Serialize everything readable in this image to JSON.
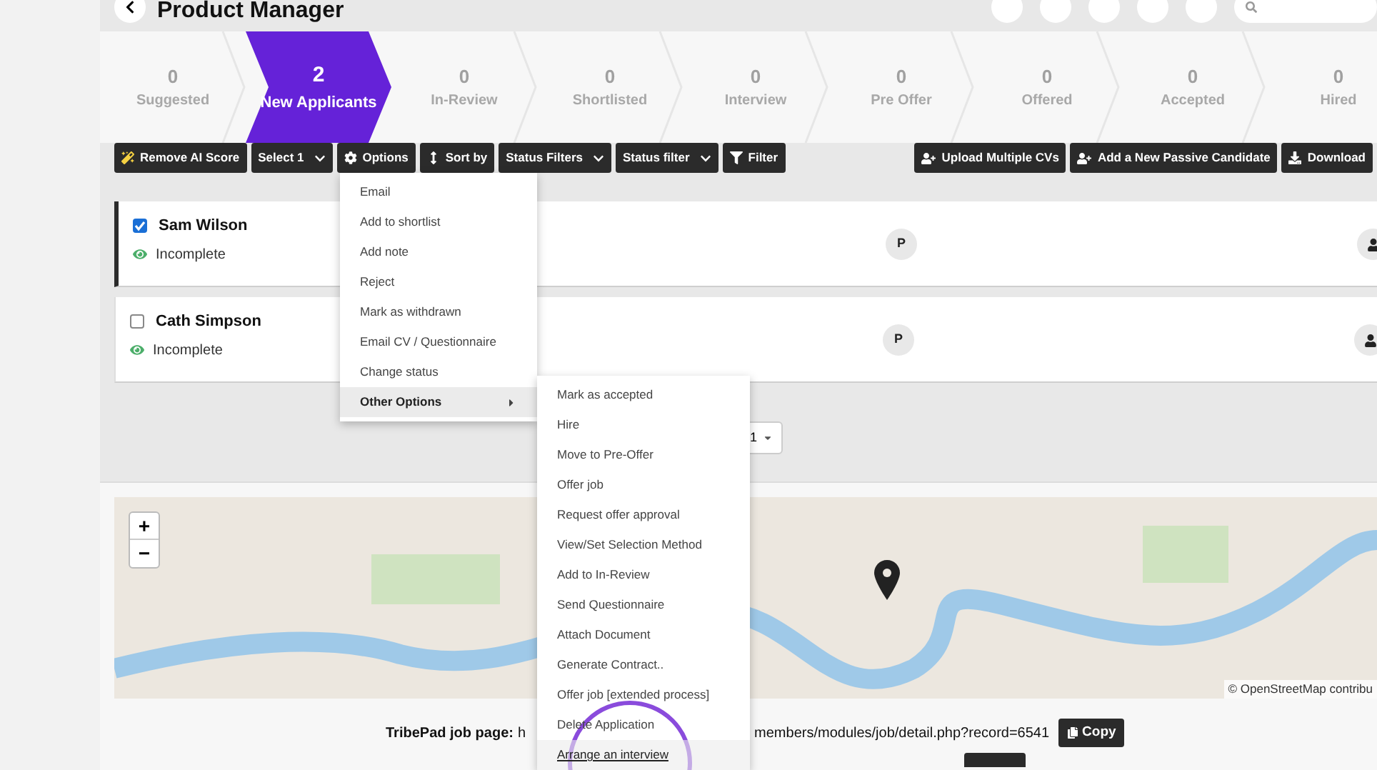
{
  "header": {
    "title": "Product Manager"
  },
  "stages": [
    {
      "count": "0",
      "label": "Suggested",
      "selected": false
    },
    {
      "count": "2",
      "label": "New Applicants",
      "selected": true
    },
    {
      "count": "0",
      "label": "In-Review",
      "selected": false
    },
    {
      "count": "0",
      "label": "Shortlisted",
      "selected": false
    },
    {
      "count": "0",
      "label": "Interview",
      "selected": false
    },
    {
      "count": "0",
      "label": "Pre Offer",
      "selected": false
    },
    {
      "count": "0",
      "label": "Offered",
      "selected": false
    },
    {
      "count": "0",
      "label": "Accepted",
      "selected": false
    },
    {
      "count": "0",
      "label": "Hired",
      "selected": false
    }
  ],
  "toolbar_left": [
    {
      "label": "Remove AI Score",
      "kind": "sparkle"
    },
    {
      "label": "Select 1",
      "kind": "dropdown"
    },
    {
      "label": "Options",
      "kind": "gear"
    },
    {
      "label": "Sort by",
      "kind": "sort"
    },
    {
      "label": "Status Filters",
      "kind": "dropdown"
    },
    {
      "label": "Status filter",
      "kind": "dropdown"
    },
    {
      "label": "Filter",
      "kind": "filter"
    }
  ],
  "toolbar_right": [
    {
      "label": "Upload Multiple CVs",
      "kind": "user-plus"
    },
    {
      "label": "Add a New Passive Candidate",
      "kind": "user-plus"
    },
    {
      "label": "Download",
      "kind": "download"
    }
  ],
  "candidates": [
    {
      "name": "Sam Wilson",
      "checked": true,
      "status": "Incomplete",
      "initial": "P"
    },
    {
      "name": "Cath Simpson",
      "checked": false,
      "status": "Incomplete",
      "initial": "P"
    }
  ],
  "pagination": {
    "page": "1"
  },
  "options_menu": [
    {
      "label": "Email",
      "selected": false,
      "has_submenu": false
    },
    {
      "label": "Add to shortlist",
      "selected": false,
      "has_submenu": false
    },
    {
      "label": "Add note",
      "selected": false,
      "has_submenu": false
    },
    {
      "label": "Reject",
      "selected": false,
      "has_submenu": false
    },
    {
      "label": "Mark as withdrawn",
      "selected": false,
      "has_submenu": false
    },
    {
      "label": "Email CV / Questionnaire",
      "selected": false,
      "has_submenu": false
    },
    {
      "label": "Change status",
      "selected": false,
      "has_submenu": false
    },
    {
      "label": "Other Options",
      "selected": true,
      "has_submenu": true
    }
  ],
  "other_options_menu": [
    {
      "label": "Mark as accepted",
      "selected": false
    },
    {
      "label": "Hire",
      "selected": false
    },
    {
      "label": "Move to Pre-Offer",
      "selected": false
    },
    {
      "label": "Offer job",
      "selected": false
    },
    {
      "label": "Request offer approval",
      "selected": false
    },
    {
      "label": "View/Set Selection Method",
      "selected": false
    },
    {
      "label": "Add to In-Review",
      "selected": false
    },
    {
      "label": "Send Questionnaire",
      "selected": false
    },
    {
      "label": "Attach Document",
      "selected": false
    },
    {
      "label": "Generate Contract..",
      "selected": false
    },
    {
      "label": "Offer job [extended process]",
      "selected": false
    },
    {
      "label": "Delete Application",
      "selected": false
    },
    {
      "label": "Arrange an interview",
      "selected": true
    }
  ],
  "map": {
    "zoom_in": "+",
    "zoom_out": "−",
    "attribution": "© OpenStreetMap contribu"
  },
  "job_page": {
    "label": "TribePad job page:",
    "url_start": "h",
    "url_end": "members/modules/job/detail.php?record=6541",
    "copy": "Copy"
  }
}
